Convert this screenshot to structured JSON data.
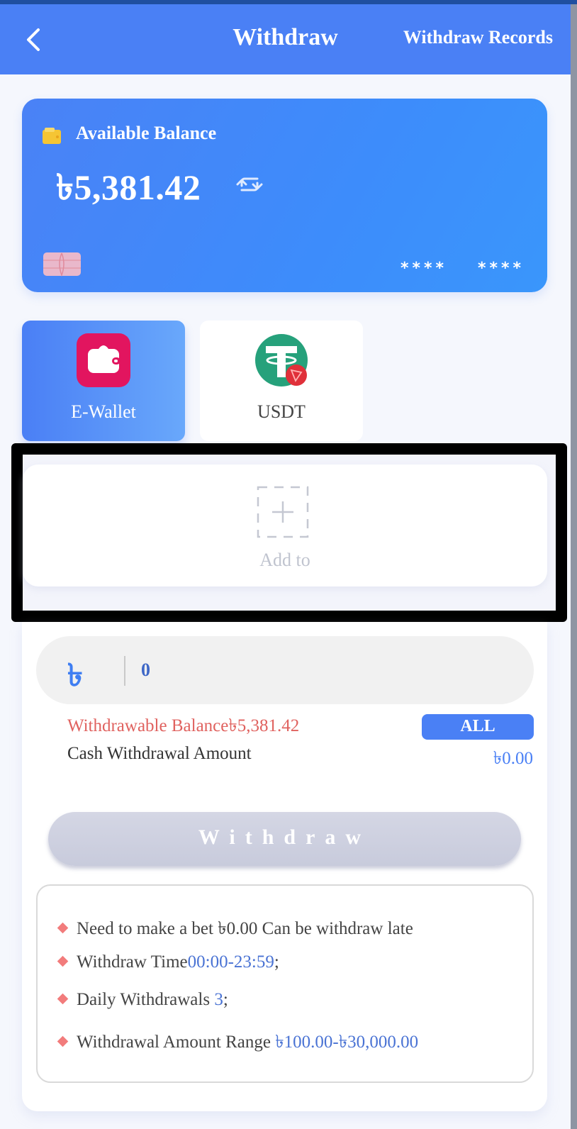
{
  "header": {
    "title": "Withdraw",
    "records_link": "Withdraw Records"
  },
  "balance_card": {
    "label": "Available Balance",
    "amount": "৳5,381.42",
    "masked_1": "****",
    "masked_2": "****"
  },
  "methods": [
    {
      "label": "E-Wallet",
      "icon": "wallet-icon",
      "active": true
    },
    {
      "label": "USDT",
      "icon": "usdt-tron-icon",
      "active": false
    }
  ],
  "add_account": {
    "label": "Add to",
    "icon": "dashed-plus-icon"
  },
  "amount_input": {
    "currency_symbol": "৳",
    "value": "0"
  },
  "withdrawable_balance": "Withdrawable Balance৳5,381.42",
  "all_button": "ALL",
  "cash_withdrawal": {
    "label": "Cash Withdrawal Amount",
    "value": "৳0.00"
  },
  "withdraw_button": "Withdraw",
  "rules": [
    {
      "text": "Need to make a bet ৳0.00 Can be withdraw late",
      "highlight": "",
      "suffix": ""
    },
    {
      "text": "Withdraw Time",
      "highlight": "00:00-23:59",
      "suffix": ";"
    },
    {
      "text": "Daily Withdrawals ",
      "highlight": "3",
      "suffix": ";"
    },
    {
      "text": "Withdrawal Amount Range ",
      "highlight": "৳100.00-৳30,000.00",
      "suffix": ""
    }
  ],
  "colors": {
    "primary": "#4a80f5",
    "warning_red": "#e0625f",
    "disabled_button": "#c8cbdc",
    "ewallet_pink": "#e2155f",
    "usdt_green": "#26a17b"
  }
}
